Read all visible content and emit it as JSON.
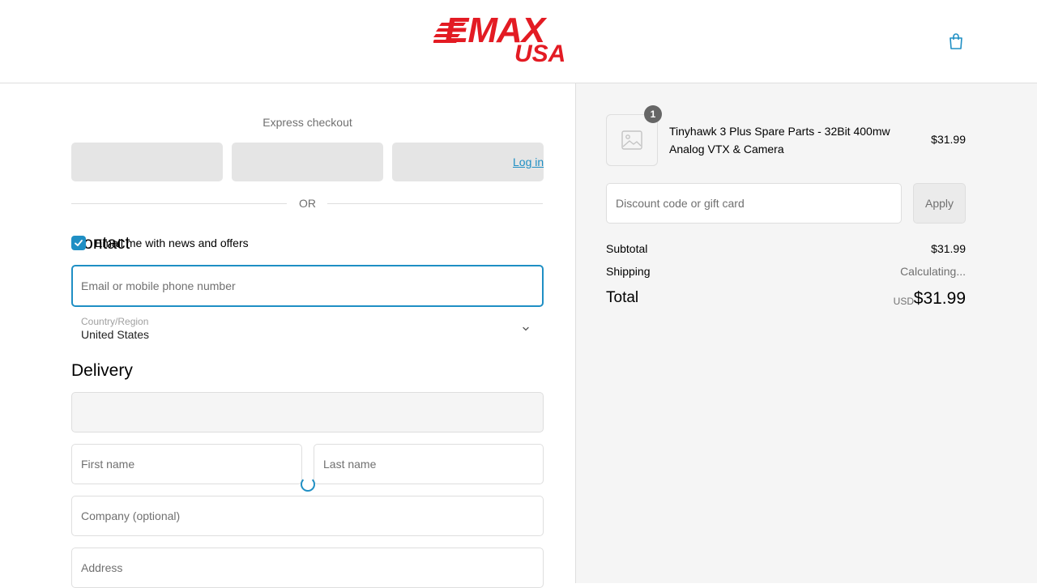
{
  "header": {
    "logo_top": "EMAX",
    "logo_bottom": "USA",
    "cart_icon": "shopping-bag-icon"
  },
  "express": {
    "title": "Express checkout",
    "or_label": "OR"
  },
  "contact": {
    "heading": "Contact",
    "login_label": "Log in",
    "email_placeholder": "Email or mobile phone number",
    "newsletter_label": "Email me with news and offers",
    "newsletter_checked": true
  },
  "delivery": {
    "heading": "Delivery",
    "country_label": "Country/Region",
    "country_value": "United States",
    "first_name_placeholder": "First name",
    "last_name_placeholder": "Last name",
    "company_placeholder": "Company (optional)",
    "address_placeholder": "Address"
  },
  "summary": {
    "product": {
      "name": "Tinyhawk 3 Plus Spare Parts - 32Bit 400mw Analog VTX & Camera",
      "price": "$31.99",
      "quantity": "1"
    },
    "discount_placeholder": "Discount code or gift card",
    "apply_label": "Apply",
    "subtotal_label": "Subtotal",
    "subtotal_value": "$31.99",
    "shipping_label": "Shipping",
    "shipping_value": "Calculating...",
    "total_label": "Total",
    "currency": "USD",
    "total_value": "$31.99"
  },
  "colors": {
    "accent": "#1f8fc4",
    "brand_red": "#e31b23"
  }
}
